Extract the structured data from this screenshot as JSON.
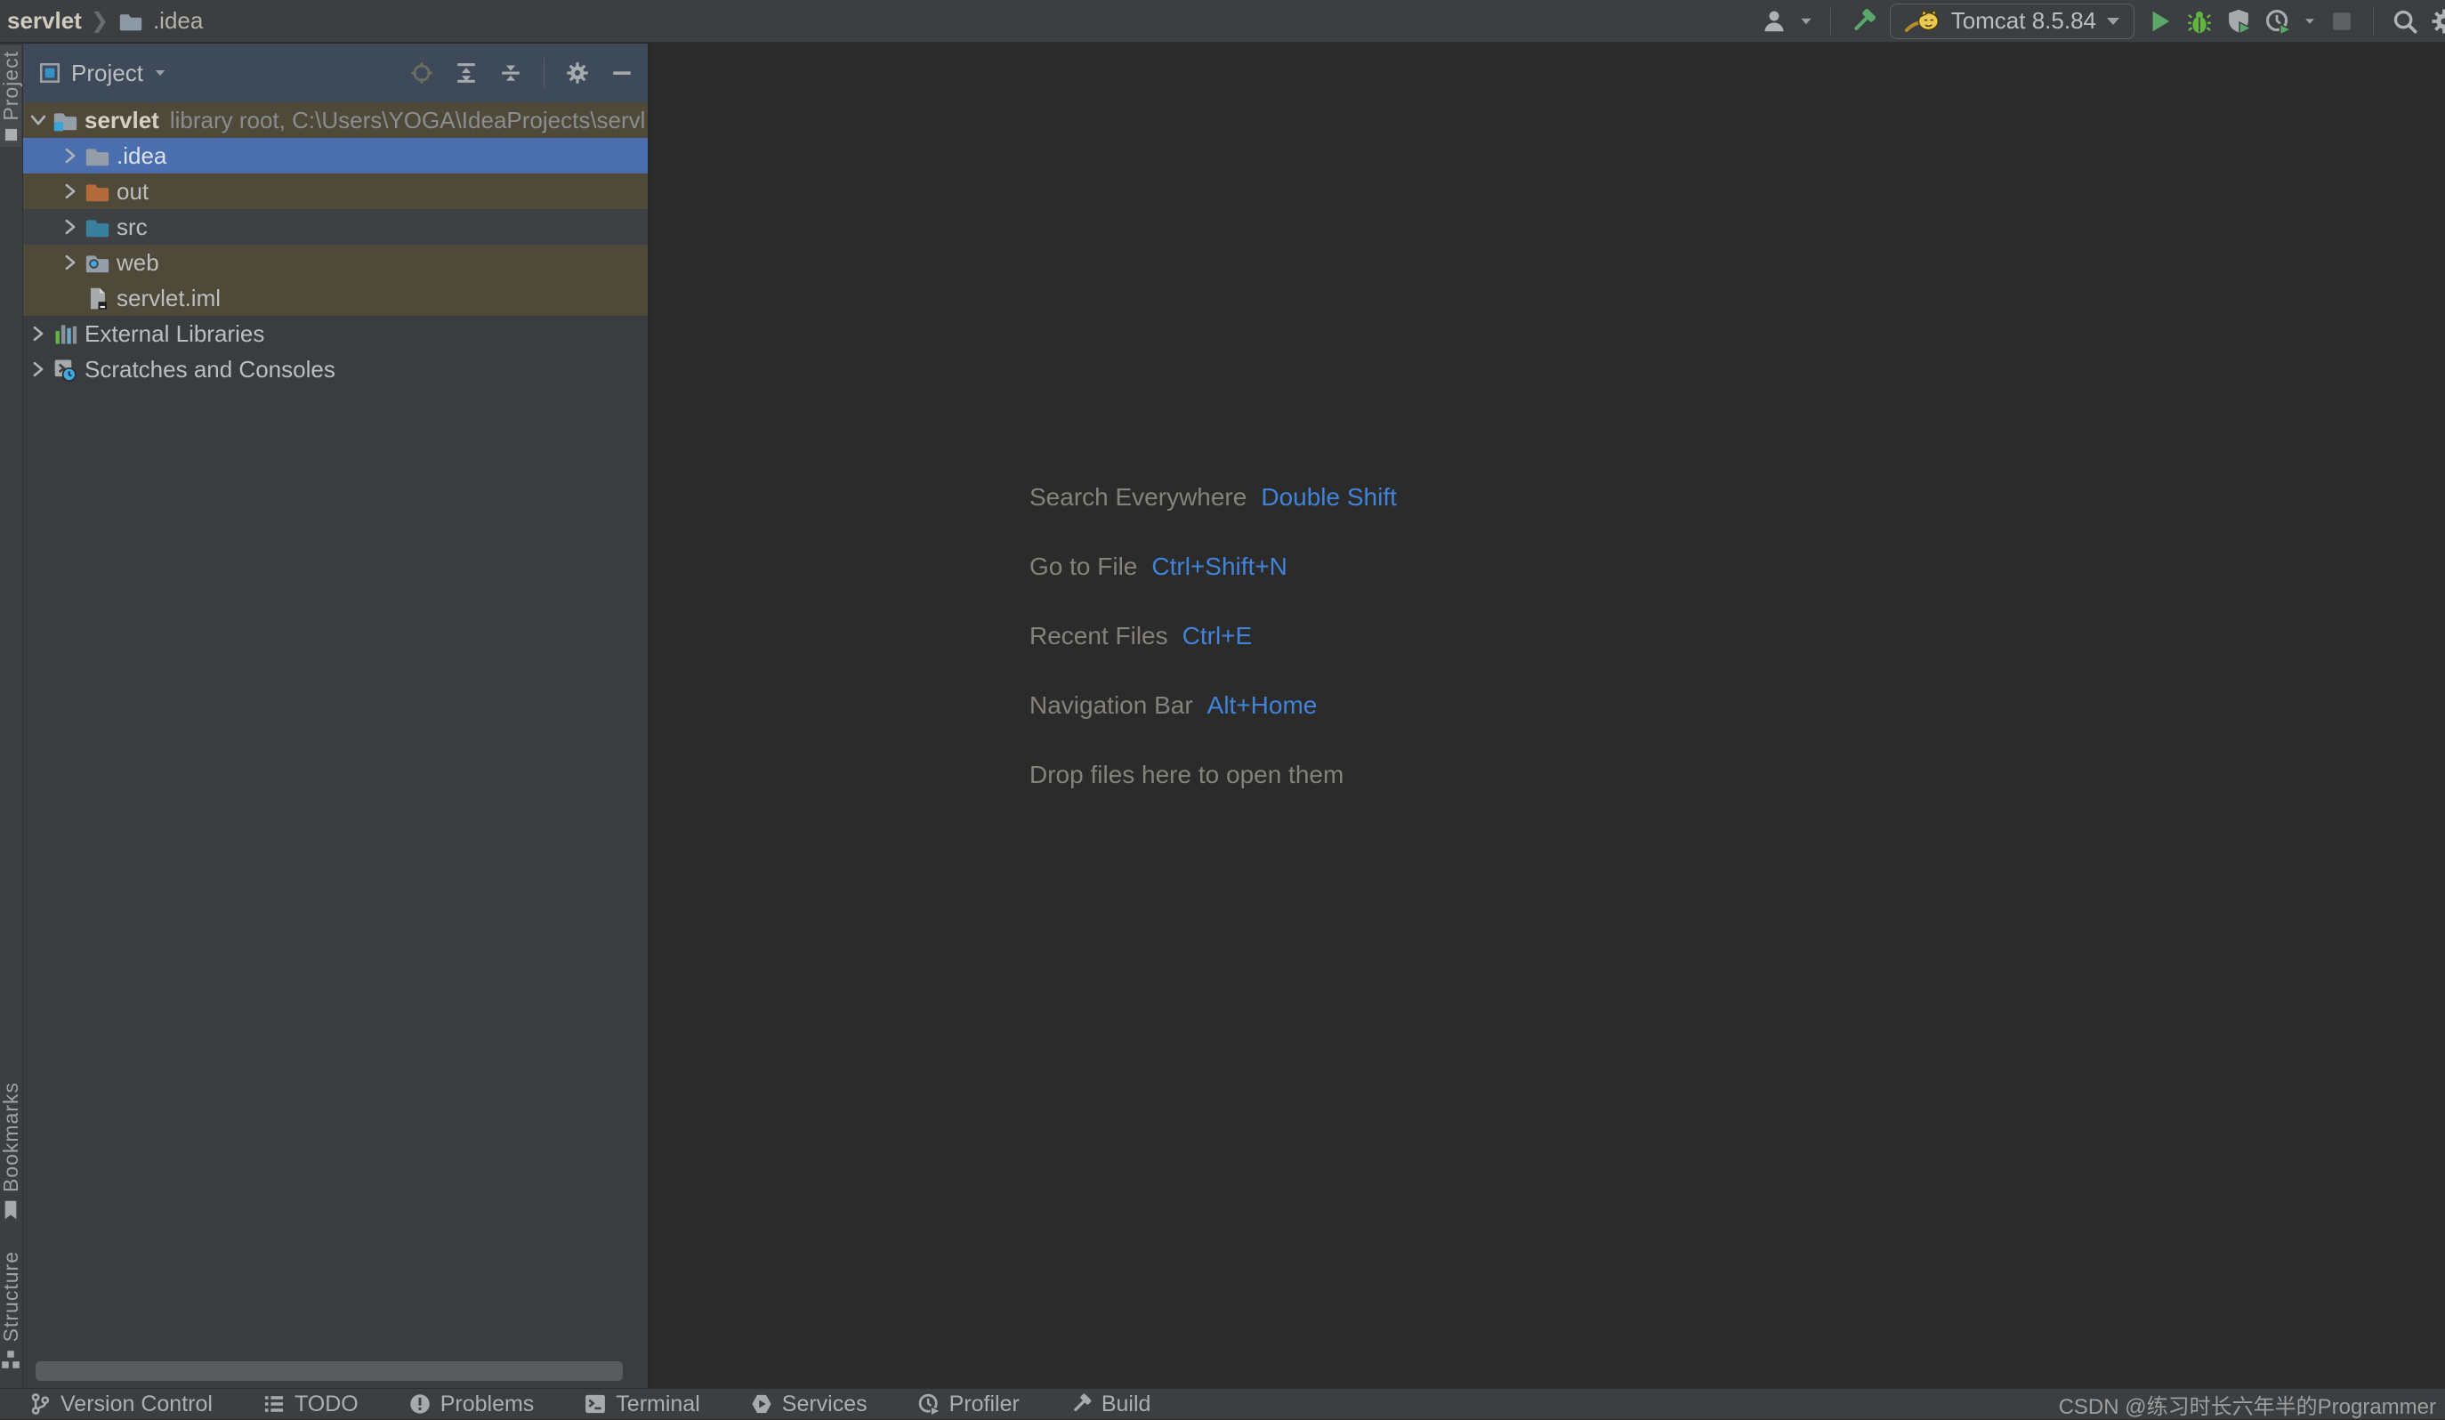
{
  "topbar": {
    "breadcrumb": {
      "root": "servlet",
      "separator": "❯",
      "current": ".idea"
    },
    "run_config": {
      "label": "Tomcat 8.5.84"
    }
  },
  "stripes": {
    "project": "Project",
    "bookmarks": "Bookmarks",
    "structure": "Structure"
  },
  "panel": {
    "title": "Project",
    "rows": [
      {
        "label": "servlet",
        "bold": true,
        "hint": "library root, C:\\Users\\YOGA\\IdeaProjects\\servl",
        "level": 0,
        "chevron": "expanded",
        "icon": "folder-project",
        "state": "olive"
      },
      {
        "label": ".idea",
        "level": 1,
        "chevron": "collapsed",
        "icon": "folder",
        "state": "selected"
      },
      {
        "label": "out",
        "level": 1,
        "chevron": "collapsed",
        "icon": "folder-excluded",
        "state": "olive"
      },
      {
        "label": "src",
        "level": 1,
        "chevron": "collapsed",
        "icon": "folder-source",
        "state": "dark"
      },
      {
        "label": "web",
        "level": 1,
        "chevron": "collapsed",
        "icon": "folder-web",
        "state": "olive"
      },
      {
        "label": "servlet.iml",
        "level": 1,
        "chevron": "none",
        "icon": "file-iml",
        "state": "olive"
      },
      {
        "label": "External Libraries",
        "level": 0,
        "chevron": "collapsed",
        "icon": "libraries",
        "state": ""
      },
      {
        "label": "Scratches and Consoles",
        "level": 0,
        "chevron": "collapsed",
        "icon": "scratches",
        "state": ""
      }
    ]
  },
  "editor": {
    "shortcuts": [
      {
        "label": "Search Everywhere",
        "keys": "Double Shift"
      },
      {
        "label": "Go to File",
        "keys": "Ctrl+Shift+N"
      },
      {
        "label": "Recent Files",
        "keys": "Ctrl+E"
      },
      {
        "label": "Navigation Bar",
        "keys": "Alt+Home"
      }
    ],
    "drop_hint": "Drop files here to open them"
  },
  "statusbar": {
    "items": [
      {
        "label": "Version Control",
        "icon": "vcs"
      },
      {
        "label": "TODO",
        "icon": "todo"
      },
      {
        "label": "Problems",
        "icon": "problems"
      },
      {
        "label": "Terminal",
        "icon": "terminal"
      },
      {
        "label": "Services",
        "icon": "services"
      },
      {
        "label": "Profiler",
        "icon": "profiler-gray"
      },
      {
        "label": "Build",
        "icon": "hammer-gray"
      }
    ],
    "watermark": "CSDN @练习时长六年半的Programmer"
  },
  "colors": {
    "chrome": "#3C3F41",
    "editor_bg": "#2B2B2B",
    "panel_bg": "#3A3D3F",
    "panel_header": "#3E4A59",
    "selection": "#4B6EAF",
    "unversioned_row": "#4F4939",
    "accent_blue": "#4083D8",
    "run_green": "#59A869",
    "debug_green": "#62B543"
  }
}
